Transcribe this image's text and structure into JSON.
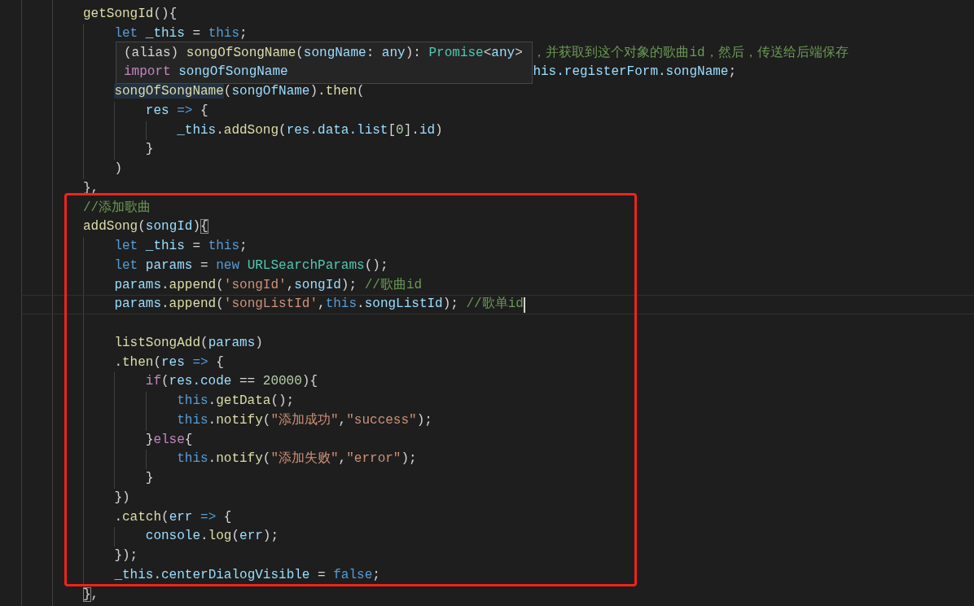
{
  "tooltip": {
    "lines": [
      [
        {
          "kind": "punct",
          "text": "(alias) "
        },
        {
          "kind": "fn",
          "text": "songOfSongName"
        },
        {
          "kind": "punct",
          "text": "("
        },
        {
          "kind": "var",
          "text": "songName"
        },
        {
          "kind": "punct",
          "text": ": "
        },
        {
          "kind": "var",
          "text": "any"
        },
        {
          "kind": "punct",
          "text": "): "
        },
        {
          "kind": "type",
          "text": "Promise"
        },
        {
          "kind": "punct",
          "text": "<"
        },
        {
          "kind": "var",
          "text": "any"
        },
        {
          "kind": "punct",
          "text": ">"
        }
      ],
      [
        {
          "kind": "control",
          "text": "import "
        },
        {
          "kind": "var",
          "text": "songOfSongName"
        }
      ]
    ]
  },
  "code": [
    {
      "tokens": [
        {
          "kind": "fn",
          "text": "getSongId"
        },
        {
          "kind": "punct",
          "text": "(){"
        }
      ],
      "children": [
        {
          "tokens": [
            {
              "kind": "kw",
              "text": "let"
            },
            {
              "kind": "var",
              "text": " _this"
            },
            {
              "kind": "punct",
              "text": " = "
            },
            {
              "kind": "kw",
              "text": "this"
            },
            {
              "kind": "punct",
              "text": ";"
            }
          ]
        },
        {
          "hidden_start": true,
          "tokens": [
            {
              "kind": "comment",
              "text": "，并获取到这个对象的歌曲id，然后，传送给后端保存"
            }
          ]
        },
        {
          "hidden_start": true,
          "tokens": [
            {
              "kind": "var",
              "text": "his.registerForm.songName"
            },
            {
              "kind": "punct",
              "text": ";"
            }
          ]
        },
        {
          "tokens": [
            {
              "kind": "fn_hover",
              "text": "songOfSongName"
            },
            {
              "kind": "punct",
              "text": "("
            },
            {
              "kind": "var",
              "text": "songOfName"
            },
            {
              "kind": "punct",
              "text": ")."
            },
            {
              "kind": "fn",
              "text": "then"
            },
            {
              "kind": "punct",
              "text": "("
            }
          ],
          "children": [
            {
              "tokens": [
                {
                  "kind": "var",
                  "text": "res"
                },
                {
                  "kind": "kw",
                  "text": " => "
                },
                {
                  "kind": "punct",
                  "text": "{"
                }
              ],
              "children": [
                {
                  "tokens": [
                    {
                      "kind": "var",
                      "text": "_this"
                    },
                    {
                      "kind": "punct",
                      "text": "."
                    },
                    {
                      "kind": "fn",
                      "text": "addSong"
                    },
                    {
                      "kind": "punct",
                      "text": "("
                    },
                    {
                      "kind": "var",
                      "text": "res.data.list"
                    },
                    {
                      "kind": "punct",
                      "text": "["
                    },
                    {
                      "kind": "number",
                      "text": "0"
                    },
                    {
                      "kind": "punct",
                      "text": "]."
                    },
                    {
                      "kind": "var",
                      "text": "id"
                    },
                    {
                      "kind": "punct",
                      "text": ")"
                    }
                  ]
                }
              ]
            },
            {
              "tokens": [
                {
                  "kind": "punct",
                  "text": "}"
                }
              ]
            }
          ]
        },
        {
          "tokens": [
            {
              "kind": "punct",
              "text": ")"
            }
          ]
        }
      ]
    },
    {
      "tokens": [
        {
          "kind": "punct",
          "text": "},"
        }
      ]
    },
    {
      "tokens": [
        {
          "kind": "comment",
          "text": "//添加歌曲"
        }
      ]
    },
    {
      "tokens": [
        {
          "kind": "fn",
          "text": "addSong"
        },
        {
          "kind": "punct",
          "text": "("
        },
        {
          "kind": "var",
          "text": "songId"
        },
        {
          "kind": "punct",
          "text": ")"
        },
        {
          "kind": "brace_match",
          "text": "{"
        }
      ],
      "children": [
        {
          "tokens": [
            {
              "kind": "kw",
              "text": "let"
            },
            {
              "kind": "var",
              "text": " _this"
            },
            {
              "kind": "punct",
              "text": " = "
            },
            {
              "kind": "kw",
              "text": "this"
            },
            {
              "kind": "punct",
              "text": ";"
            }
          ]
        },
        {
          "tokens": [
            {
              "kind": "kw",
              "text": "let"
            },
            {
              "kind": "var",
              "text": " params"
            },
            {
              "kind": "punct",
              "text": " = "
            },
            {
              "kind": "kw",
              "text": "new "
            },
            {
              "kind": "type",
              "text": "URLSearchParams"
            },
            {
              "kind": "punct",
              "text": "();"
            }
          ]
        },
        {
          "tokens": [
            {
              "kind": "var",
              "text": "params"
            },
            {
              "kind": "punct",
              "text": "."
            },
            {
              "kind": "fn",
              "text": "append"
            },
            {
              "kind": "punct",
              "text": "("
            },
            {
              "kind": "string",
              "text": "'songId'"
            },
            {
              "kind": "punct",
              "text": ","
            },
            {
              "kind": "var",
              "text": "songId"
            },
            {
              "kind": "punct",
              "text": "); "
            },
            {
              "kind": "comment",
              "text": "//歌曲id"
            }
          ]
        },
        {
          "current": true,
          "tokens": [
            {
              "kind": "var",
              "text": "params"
            },
            {
              "kind": "punct",
              "text": "."
            },
            {
              "kind": "fn",
              "text": "append"
            },
            {
              "kind": "punct",
              "text": "("
            },
            {
              "kind": "string",
              "text": "'songListId'"
            },
            {
              "kind": "punct",
              "text": ","
            },
            {
              "kind": "kw",
              "text": "this"
            },
            {
              "kind": "punct",
              "text": "."
            },
            {
              "kind": "var",
              "text": "songListId"
            },
            {
              "kind": "punct",
              "text": "); "
            },
            {
              "kind": "comment",
              "text": "//歌单id"
            }
          ]
        },
        {
          "kind": "blank"
        },
        {
          "tokens": [
            {
              "kind": "fn",
              "text": "listSongAdd"
            },
            {
              "kind": "punct",
              "text": "("
            },
            {
              "kind": "var",
              "text": "params"
            },
            {
              "kind": "punct",
              "text": ")"
            }
          ]
        },
        {
          "tokens": [
            {
              "kind": "punct",
              "text": "."
            },
            {
              "kind": "fn",
              "text": "then"
            },
            {
              "kind": "punct",
              "text": "("
            },
            {
              "kind": "var",
              "text": "res"
            },
            {
              "kind": "kw",
              "text": " => "
            },
            {
              "kind": "punct",
              "text": "{"
            }
          ],
          "children": [
            {
              "tokens": [
                {
                  "kind": "control",
                  "text": "if"
                },
                {
                  "kind": "punct",
                  "text": "("
                },
                {
                  "kind": "var",
                  "text": "res.code"
                },
                {
                  "kind": "punct",
                  "text": " == "
                },
                {
                  "kind": "number",
                  "text": "20000"
                },
                {
                  "kind": "punct",
                  "text": "){"
                }
              ],
              "children": [
                {
                  "tokens": [
                    {
                      "kind": "kw",
                      "text": "this"
                    },
                    {
                      "kind": "punct",
                      "text": "."
                    },
                    {
                      "kind": "fn",
                      "text": "getData"
                    },
                    {
                      "kind": "punct",
                      "text": "();"
                    }
                  ]
                },
                {
                  "tokens": [
                    {
                      "kind": "kw",
                      "text": "this"
                    },
                    {
                      "kind": "punct",
                      "text": "."
                    },
                    {
                      "kind": "fn",
                      "text": "notify"
                    },
                    {
                      "kind": "punct",
                      "text": "("
                    },
                    {
                      "kind": "string",
                      "text": "\"添加成功\""
                    },
                    {
                      "kind": "punct",
                      "text": ","
                    },
                    {
                      "kind": "string",
                      "text": "\"success\""
                    },
                    {
                      "kind": "punct",
                      "text": ");"
                    }
                  ]
                }
              ]
            },
            {
              "tokens": [
                {
                  "kind": "punct",
                  "text": "}"
                },
                {
                  "kind": "control",
                  "text": "else"
                },
                {
                  "kind": "punct",
                  "text": "{"
                }
              ],
              "children": [
                {
                  "tokens": [
                    {
                      "kind": "kw",
                      "text": "this"
                    },
                    {
                      "kind": "punct",
                      "text": "."
                    },
                    {
                      "kind": "fn",
                      "text": "notify"
                    },
                    {
                      "kind": "punct",
                      "text": "("
                    },
                    {
                      "kind": "string",
                      "text": "\"添加失败\""
                    },
                    {
                      "kind": "punct",
                      "text": ","
                    },
                    {
                      "kind": "string",
                      "text": "\"error\""
                    },
                    {
                      "kind": "punct",
                      "text": ");"
                    }
                  ]
                }
              ]
            },
            {
              "tokens": [
                {
                  "kind": "punct",
                  "text": "}"
                }
              ]
            }
          ]
        },
        {
          "tokens": [
            {
              "kind": "punct",
              "text": "})"
            }
          ]
        },
        {
          "tokens": [
            {
              "kind": "punct",
              "text": "."
            },
            {
              "kind": "fn",
              "text": "catch"
            },
            {
              "kind": "punct",
              "text": "("
            },
            {
              "kind": "var",
              "text": "err"
            },
            {
              "kind": "kw",
              "text": " => "
            },
            {
              "kind": "punct",
              "text": "{"
            }
          ],
          "children": [
            {
              "tokens": [
                {
                  "kind": "var",
                  "text": "console"
                },
                {
                  "kind": "punct",
                  "text": "."
                },
                {
                  "kind": "fn",
                  "text": "log"
                },
                {
                  "kind": "punct",
                  "text": "("
                },
                {
                  "kind": "var",
                  "text": "err"
                },
                {
                  "kind": "punct",
                  "text": ");"
                }
              ]
            }
          ]
        },
        {
          "tokens": [
            {
              "kind": "punct",
              "text": "});"
            }
          ]
        },
        {
          "tokens": [
            {
              "kind": "var",
              "text": "_this"
            },
            {
              "kind": "punct",
              "text": "."
            },
            {
              "kind": "var",
              "text": "centerDialogVisible"
            },
            {
              "kind": "punct",
              "text": " = "
            },
            {
              "kind": "kw",
              "text": "false"
            },
            {
              "kind": "punct",
              "text": ";"
            }
          ]
        }
      ]
    },
    {
      "tokens": [
        {
          "kind": "brace_match",
          "text": "}"
        },
        {
          "kind": "punct",
          "text": ","
        }
      ]
    }
  ]
}
